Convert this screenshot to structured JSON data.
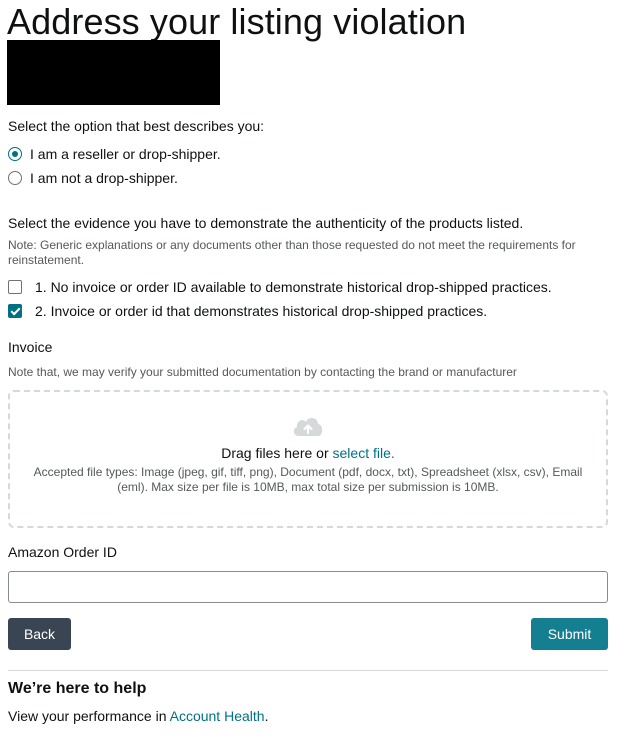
{
  "page": {
    "title": "Address your listing violation",
    "seller_question": "Select the option that best describes you:",
    "seller_options": [
      {
        "label": "I am a reseller or drop-shipper.",
        "selected": true
      },
      {
        "label": "I am not a drop-shipper.",
        "selected": false
      }
    ],
    "evidence_question": "Select the evidence you have to demonstrate the authenticity of the products listed.",
    "evidence_note": "Note: Generic explanations or any documents other than those requested do not meet the requirements for reinstatement.",
    "evidence_options": [
      {
        "label": "1. No invoice or order ID available to demonstrate historical drop-shipped practices.",
        "checked": false
      },
      {
        "label": "2. Invoice or order id that demonstrates historical drop-shipped practices.",
        "checked": true
      }
    ]
  },
  "invoice": {
    "label": "Invoice",
    "note": "Note that, we may verify your submitted documentation by contacting the brand or manufacturer",
    "drop_text": "Drag files here or ",
    "select_link": "select file.",
    "accepted_line1": "Accepted file types: Image (jpeg, gif, tiff, png), Document (pdf, docx, txt), Spreadsheet (xlsx, csv), Email",
    "accepted_line2": "(eml). Max size per file is 10MB, max total size per submission is 10MB."
  },
  "order": {
    "label": "Amazon Order ID",
    "value": "",
    "placeholder": ""
  },
  "actions": {
    "back_label": "Back",
    "submit_label": "Submit"
  },
  "help": {
    "heading": "We’re here to help",
    "text": "View your performance in ",
    "link": "Account Health",
    "period": "."
  },
  "colors": {
    "accent": "#007185",
    "submit": "#137f91",
    "back": "#3a4553"
  },
  "icons": {
    "upload": "cloud-upload-icon"
  }
}
